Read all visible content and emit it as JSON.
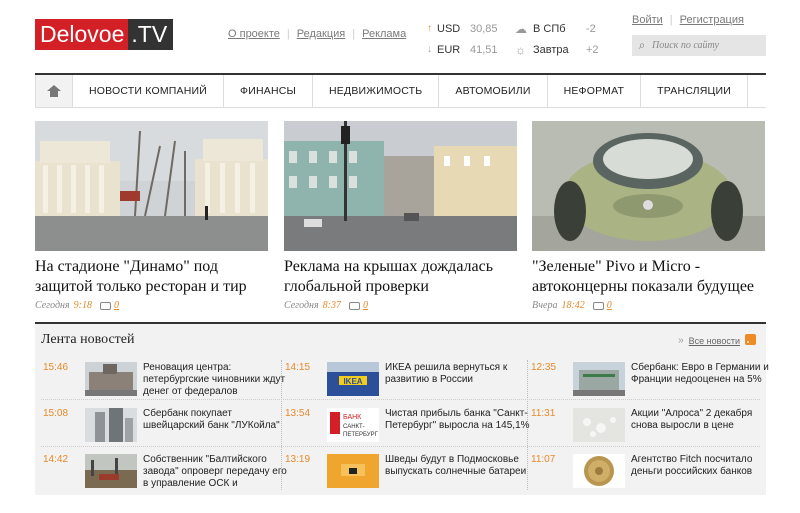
{
  "logo": {
    "part1": "Delovoe",
    "part2": ".TV"
  },
  "top_links": [
    "О проекте",
    "Редакция",
    "Реклама"
  ],
  "rates": [
    {
      "dir": "up",
      "currency": "USD",
      "value": "30,85"
    },
    {
      "dir": "down",
      "currency": "EUR",
      "value": "41,51"
    }
  ],
  "weather": [
    {
      "icon": "cloud-icon",
      "label": "В СПб",
      "temp": "-2"
    },
    {
      "icon": "sun-icon",
      "label": "Завтра",
      "temp": "+2"
    }
  ],
  "auth": {
    "login": "Войти",
    "register": "Регистрация"
  },
  "search": {
    "placeholder": "Поиск по сайту"
  },
  "nav": [
    "НОВОСТИ КОМПАНИЙ",
    "ФИНАНСЫ",
    "НЕДВИЖИМОСТЬ",
    "АВТОМОБИЛИ",
    "НЕФОРМАТ",
    "ТРАНСЛЯЦИИ"
  ],
  "featured": [
    {
      "title": "На стадионе \"Динамо\" под защитой только ресторан и тир",
      "day": "Сегодня",
      "time": "9:18",
      "comments": "0"
    },
    {
      "title": "Реклама на крышах дождалась глобальной проверки",
      "day": "Сегодня",
      "time": "8:37",
      "comments": "0"
    },
    {
      "title": "\"Зеленые\" Pivo и Micro - автоконцерны показали будущее",
      "day": "Вчера",
      "time": "18:42",
      "comments": "0"
    }
  ],
  "feed": {
    "title": "Лента новостей",
    "all_news": "Все новости",
    "items": [
      {
        "time": "15:46",
        "text": "Реновация центра: петербургские чиновники ждут денег от федералов"
      },
      {
        "time": "14:15",
        "text": "ИКЕА решила вернуться к развитию в России"
      },
      {
        "time": "12:35",
        "text": "Сбербанк: Евро в Германии и Франции недооценен на 5%"
      },
      {
        "time": "15:08",
        "text": "Сбербанк покупает швейцарский банк \"ЛУКойла\""
      },
      {
        "time": "13:54",
        "text": "Чистая прибыль банка \"Санкт-Петербург\" выросла на 145,1%"
      },
      {
        "time": "11:31",
        "text": "Акции \"Алроса\" 2 декабря снова выросли в цене"
      },
      {
        "time": "14:42",
        "text": "Собственник \"Балтийского завода\" опроверг передачу его в управление ОСК и"
      },
      {
        "time": "13:19",
        "text": "Шведы будут в Подмосковье выпускать солнечные батареи"
      },
      {
        "time": "11:07",
        "text": "Агентство Fitch посчитало деньги российских банков"
      }
    ],
    "thumb_texts": {
      "ikea": "IKEA",
      "bank1": "БАНК",
      "bank2": "САНКТ-",
      "bank3": "ПЕТЕРБУРГ"
    }
  }
}
